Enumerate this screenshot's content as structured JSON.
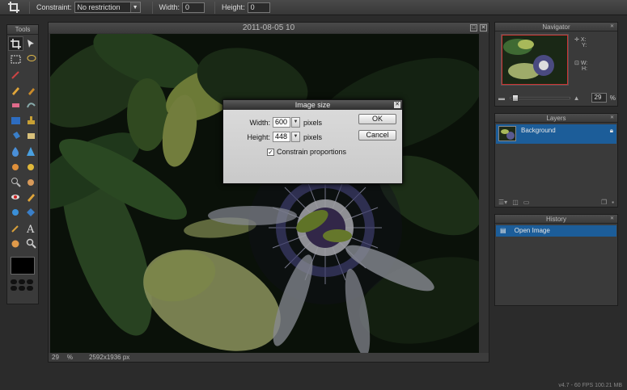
{
  "toolbar": {
    "constraint_label": "Constraint:",
    "constraint_value": "No restriction",
    "width_label": "Width:",
    "width_value": "0",
    "height_label": "Height:",
    "height_value": "0"
  },
  "tools_panel": {
    "title": "Tools"
  },
  "image_window": {
    "title": "2011-08-05 10",
    "zoom": "29",
    "zoom_unit": "%",
    "dimensions": "2592x1936 px"
  },
  "dialog": {
    "title": "Image size",
    "width_label": "Width:",
    "width_value": "600",
    "width_unit": "pixels",
    "height_label": "Height:",
    "height_value": "448",
    "height_unit": "pixels",
    "constrain_label": "Constrain proportions",
    "constrain_checked": true,
    "ok_label": "OK",
    "cancel_label": "Cancel"
  },
  "navigator": {
    "title": "Navigator",
    "x_label": "X:",
    "y_label": "Y:",
    "w_label": "W:",
    "h_label": "H:",
    "zoom_value": "29",
    "zoom_unit": "%"
  },
  "layers": {
    "title": "Layers",
    "items": [
      {
        "name": "Background"
      }
    ]
  },
  "history": {
    "title": "History",
    "items": [
      {
        "name": "Open Image"
      }
    ]
  },
  "footer": {
    "status": "v4.7 - 60 FPS 100.21 MB"
  },
  "colors": {
    "accent": "#1c5d99",
    "panel": "#3a3a3a",
    "background": "#2b2b2b"
  }
}
